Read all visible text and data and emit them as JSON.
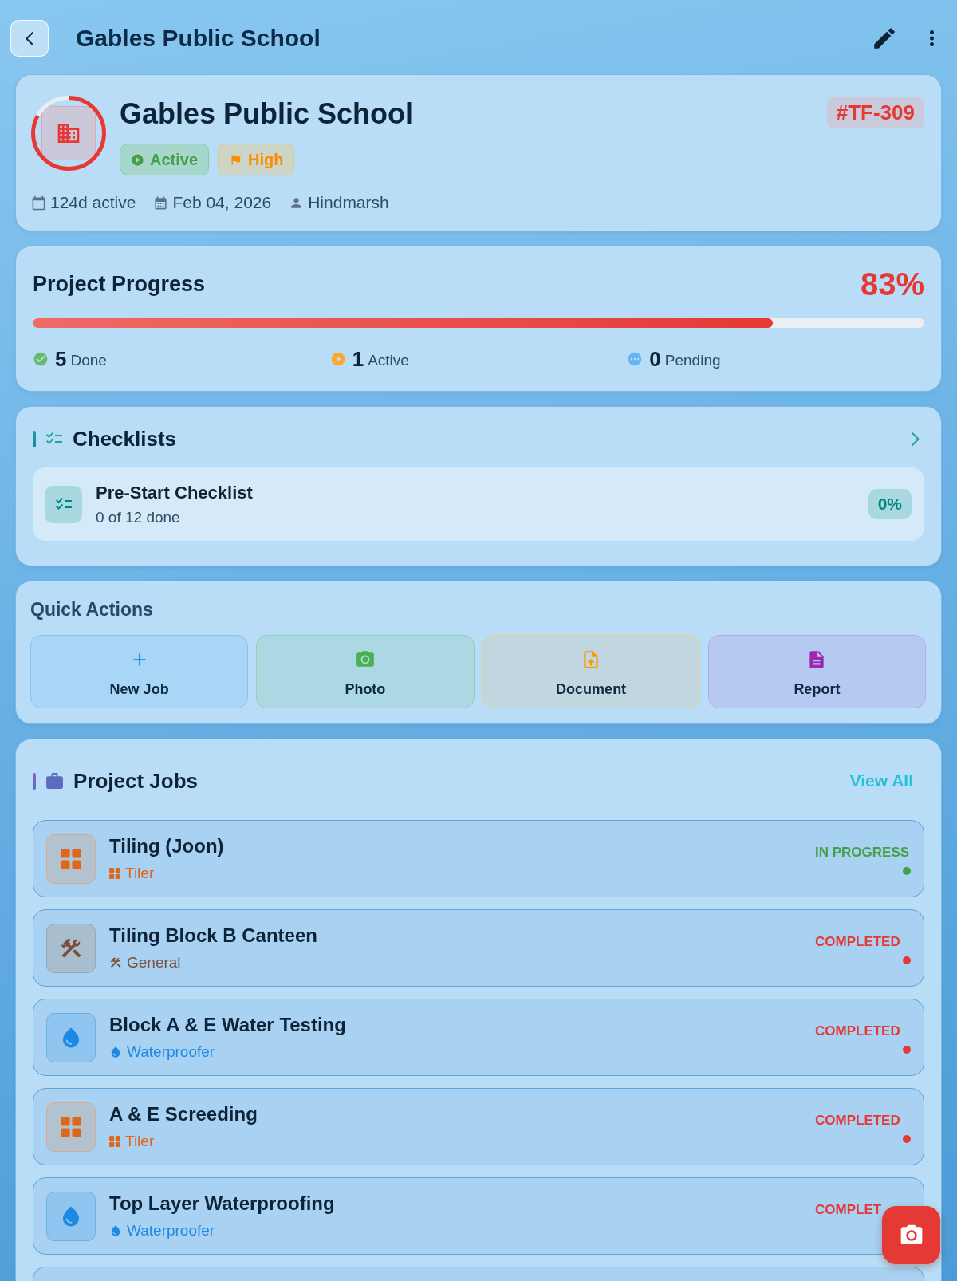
{
  "header": {
    "title": "Gables Public School"
  },
  "project": {
    "name": "Gables Public School",
    "code": "#TF-309",
    "badges": [
      {
        "kind": "status",
        "label": "Active"
      },
      {
        "kind": "priority",
        "label": "High"
      }
    ],
    "meta": [
      {
        "kind": "duration",
        "text": "124d active"
      },
      {
        "kind": "date",
        "text": "Feb 04, 2026"
      },
      {
        "kind": "person",
        "text": "Hindmarsh"
      }
    ]
  },
  "progress": {
    "title": "Project Progress",
    "percent": "83%",
    "level": 0.83,
    "stats": [
      {
        "kind": "done",
        "count": "5",
        "label": "Done"
      },
      {
        "kind": "active",
        "count": "1",
        "label": "Active"
      },
      {
        "kind": "pending",
        "count": "0",
        "label": "Pending"
      }
    ]
  },
  "checklists": {
    "title": "Checklists",
    "items": [
      {
        "name": "Pre-Start Checklist",
        "detail": "0 of 12 done",
        "percent": "0%"
      }
    ]
  },
  "quick_actions": {
    "title": "Quick Actions",
    "actions": [
      {
        "kind": "new_job",
        "label": "New Job"
      },
      {
        "kind": "photo",
        "label": "Photo"
      },
      {
        "kind": "document",
        "label": "Document"
      },
      {
        "kind": "report",
        "label": "Report"
      }
    ]
  },
  "project_jobs": {
    "title": "Project Jobs",
    "link": "View All",
    "jobs": [
      {
        "title": "Tiling (Joon)",
        "trade": "Tiler",
        "kind": "tiler",
        "status": "IN PROGRESS",
        "color": "#43a047",
        "status_dot": true
      },
      {
        "title": "Tiling Block B Canteen",
        "trade": "General",
        "kind": "general",
        "status": "COMPLETED",
        "color": "#e53935",
        "status_dot": true
      },
      {
        "title": "Block A & E Water Testing",
        "trade": "Waterproofer",
        "kind": "waterproofer",
        "status": "COMPLETED",
        "color": "#e53935",
        "status_dot": true
      },
      {
        "title": "A & E Screeding",
        "trade": "Tiler",
        "kind": "tiler",
        "status": "COMPLETED",
        "color": "#e53935",
        "status_dot": true
      },
      {
        "title": "Top Layer Waterproofing",
        "trade": "Waterproofer",
        "kind": "waterproofer",
        "status": "COMPLET",
        "color": "#e53935",
        "status_dot": false
      }
    ]
  }
}
